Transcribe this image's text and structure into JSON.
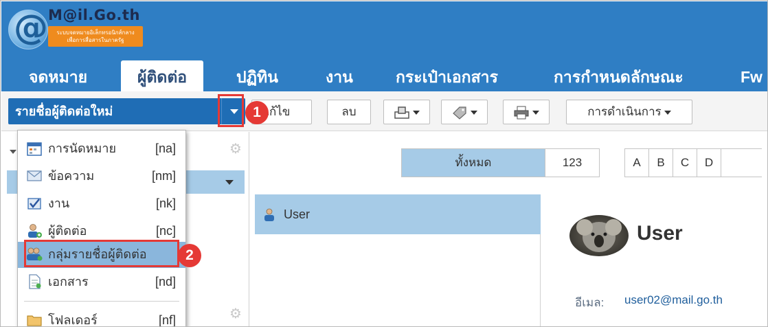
{
  "logo": {
    "title": "M@il.Go.th",
    "subtitle_line1": "ระบบจดหมายอิเล็กทรอนิกส์กลาง",
    "subtitle_line2": "เพื่อการสื่อสารในภาครัฐ"
  },
  "tabs": [
    {
      "label": "จดหมาย",
      "active": false
    },
    {
      "label": "ผู้ติดต่อ",
      "active": true
    },
    {
      "label": "ปฏิทิน",
      "active": false
    },
    {
      "label": "งาน",
      "active": false
    },
    {
      "label": "กระเป๋าเอกสาร",
      "active": false
    },
    {
      "label": "การกำหนดลักษณะ",
      "active": false
    },
    {
      "label": "Fw",
      "active": false
    }
  ],
  "toolbar": {
    "new_contact_label": "รายชื่อผู้ติดต่อใหม่",
    "edit_label": "แก้ไข",
    "delete_label": "ลบ",
    "actions_label": "การดำเนินการ"
  },
  "annotations": {
    "badge1": "1",
    "badge2": "2"
  },
  "menu": {
    "items": [
      {
        "label": "การนัดหมาย",
        "shortcut": "[na]",
        "icon": "calendar-icon"
      },
      {
        "label": "ข้อความ",
        "shortcut": "[nm]",
        "icon": "envelope-icon"
      },
      {
        "label": "งาน",
        "shortcut": "[nk]",
        "icon": "task-icon"
      },
      {
        "label": "ผู้ติดต่อ",
        "shortcut": "[nc]",
        "icon": "contact-icon"
      },
      {
        "label": "กลุ่มรายชื่อผู้ติดต่อ",
        "shortcut": "",
        "icon": "contact-group-icon"
      },
      {
        "label": "เอกสาร",
        "shortcut": "[nd]",
        "icon": "document-icon"
      },
      {
        "label": "โฟลเดอร์",
        "shortcut": "[nf]",
        "icon": "folder-icon"
      }
    ]
  },
  "alphabet": [
    "ทั้งหมด",
    "123",
    "A",
    "B",
    "C",
    "D"
  ],
  "contacts": [
    {
      "name": "User"
    }
  ],
  "detail": {
    "name": "User",
    "email_label": "อีเมล:",
    "email": "user02@mail.go.th"
  },
  "colors": {
    "header_blue": "#2f7ec4",
    "primary_button": "#1f6db5",
    "selection": "#a6cbe7",
    "highlight_red": "#e53935"
  }
}
